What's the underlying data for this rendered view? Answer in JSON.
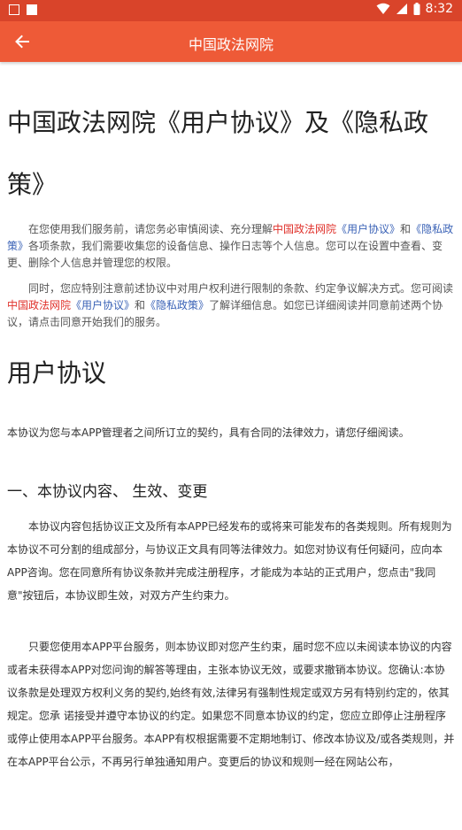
{
  "status_bar": {
    "time": "8:32",
    "icons": [
      "notification-square-icon",
      "notification-filled-icon",
      "wifi-icon",
      "signal-icon",
      "battery-icon"
    ]
  },
  "app_bar": {
    "title": "中国政法网院",
    "back_icon": "arrow-left-icon"
  },
  "colors": {
    "status_bar": "#d9442a",
    "app_bar": "#ee5a37",
    "link_red": "#e0312b",
    "link_blue": "#3a62b6"
  },
  "main": {
    "title": "中国政法网院《用户协议》及《隐私政策》",
    "intro_p1": {
      "a": "在您使用我们服务前，请您务必审慎阅读、充分理解",
      "b_red": "中国政法网院",
      "c_blue": "《用户协议》",
      "d": "和",
      "e_blue": "《隐私政策》",
      "f": "各项条款，我们需要收集您的设备信息、操作日志等个人信息。您可以在设置中查看、变更、删除个人信息并管理您的权限。"
    },
    "intro_p2": {
      "a": "同时，您应特别注意前述协议中对用户权利进行限制的条款、约定争议解决方式。您可阅读",
      "b_red": "中国政法网院",
      "c_blue": "《用户协议》",
      "d": "和",
      "e_blue": "《隐私政策》",
      "f": "了解详细信息。如您已详细阅读并同意前述两个协议，请点击同意开始我们的服务。"
    },
    "section_title": "用户协议",
    "section_intro": "本协议为您与本APP管理者之间所订立的契约，具有合同的法律效力，请您仔细阅读。",
    "subsection_title": "一、本协议内容、 生效、变更",
    "para1": "本协议内容包括协议正文及所有本APP已经发布的或将来可能发布的各类规则。所有规则为本协议不可分割的组成部分，与协议正文具有同等法律效力。如您对协议有任何疑问，应向本APP咨询。您在同意所有协议条款并完成注册程序，才能成为本站的正式用户，您点击\"我同意\"按钮后，本协议即生效，对双方产生约束力。",
    "para2": "只要您使用本APP平台服务，则本协议即对您产生约束，届时您不应以未阅读本协议的内容或者未获得本APP对您问询的解答等理由，主张本协议无效，或要求撤销本协议。您确认:本协议条款是处理双方权利义务的契约,始终有效,法律另有强制性规定或双方另有特别约定的，依其规定。您承 诺接受并遵守本协议的约定。如果您不同意本协议的约定，您应立即停止注册程序或停止使用本APP平台服务。本APP有权根据需要不定期地制订、修改本协议及/或各类规则，并在本APP平台公示，不再另行单独通知用户。变更后的协议和规则一经在网站公布，"
  }
}
